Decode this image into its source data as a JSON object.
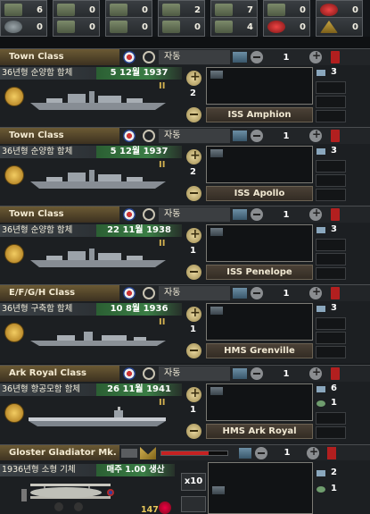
{
  "resources_top": [
    {
      "icon": "soldier-icon",
      "value": "6"
    },
    {
      "icon": "tank-icon",
      "value": "0"
    },
    {
      "icon": "boat-icon",
      "value": "0"
    },
    {
      "icon": "plane-icon",
      "value": "2"
    },
    {
      "icon": "anchor-icon",
      "value": "7"
    },
    {
      "icon": "support-icon",
      "value": "0"
    },
    {
      "icon": "crosshair-icon",
      "value": "0"
    }
  ],
  "resources_bottom": [
    {
      "icon": "gear-icon",
      "value": "0"
    },
    {
      "icon": "tank-icon",
      "value": "0"
    },
    {
      "icon": "artillery-icon",
      "value": "0"
    },
    {
      "icon": "ship-icon",
      "value": "0"
    },
    {
      "icon": "truck-icon",
      "value": "4"
    },
    {
      "icon": "medic-icon",
      "value": "0"
    },
    {
      "icon": "warning-icon",
      "value": "0"
    }
  ],
  "auto_label": "자동",
  "divisions": [
    {
      "class_name": "Town Class",
      "subtitle": "36년형 순양함 함체",
      "date": "5 12월 1937",
      "rank": "II",
      "count": "2",
      "fleet_qty": "1",
      "ship_name": "ISS Amphion",
      "stat1": "3",
      "stat2": "",
      "type": "cruiser"
    },
    {
      "class_name": "Town Class",
      "subtitle": "36년형 순양함 함체",
      "date": "5 12월 1937",
      "rank": "II",
      "count": "2",
      "fleet_qty": "1",
      "ship_name": "ISS Apollo",
      "stat1": "3",
      "stat2": "",
      "type": "cruiser"
    },
    {
      "class_name": "Town Class",
      "subtitle": "36년형 순양함 함체",
      "date": "22 11월 1938",
      "rank": "II",
      "count": "1",
      "fleet_qty": "1",
      "ship_name": "ISS Penelope",
      "stat1": "3",
      "stat2": "",
      "type": "cruiser"
    },
    {
      "class_name": "E/F/G/H Class",
      "subtitle": "36년형 구축함 함체",
      "date": "10 8월 1936",
      "rank": "II",
      "count": "1",
      "fleet_qty": "1",
      "ship_name": "HMS Grenville",
      "stat1": "3",
      "stat2": "",
      "type": "destroyer"
    },
    {
      "class_name": "Ark Royal Class",
      "subtitle": "36년형 항공모함 함체",
      "date": "26 11월 1941",
      "rank": "II",
      "count": "1",
      "fleet_qty": "1",
      "ship_name": "HMS Ark Royal",
      "stat1": "6",
      "stat2": "1",
      "type": "carrier"
    }
  ],
  "air_wing": {
    "name": "Gloster Gladiator Mk. I",
    "subtitle": "1936년형 소형 기체",
    "production": "매주 1.00 생산",
    "count": "147",
    "multiplier": "x10",
    "qty": "1",
    "stat1": "2",
    "stat2": "1",
    "bar_fraction": 0.72
  },
  "colors": {
    "header_gold": "#6b5a34",
    "date_green": "#3a7d45",
    "trash_red": "#b21f1f"
  }
}
